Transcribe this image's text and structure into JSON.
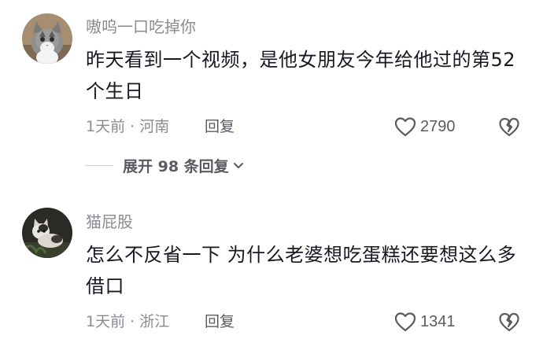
{
  "comments": [
    {
      "username": "嗷呜一口吃掉你",
      "text": "昨天看到一个视频，是他女朋友今年给他过的第52个生日",
      "time": "1天前",
      "location": "河南",
      "reply_label": "回复",
      "like_count": "2790",
      "avatar_icon": "cat-avatar-icon"
    },
    {
      "username": "猫屁股",
      "text": "怎么不反省一下 为什么老婆想吃蛋糕还要想这么多借口",
      "time": "1天前",
      "location": "浙江",
      "reply_label": "回复",
      "like_count": "1341",
      "avatar_icon": "cat-photo-avatar-icon"
    }
  ],
  "expand_replies": {
    "label": "展开 98 条回复"
  },
  "meta_separator": "·",
  "colors": {
    "text_primary": "#161823",
    "text_secondary": "#8a8b91",
    "icon_gray": "#5a5b62"
  }
}
